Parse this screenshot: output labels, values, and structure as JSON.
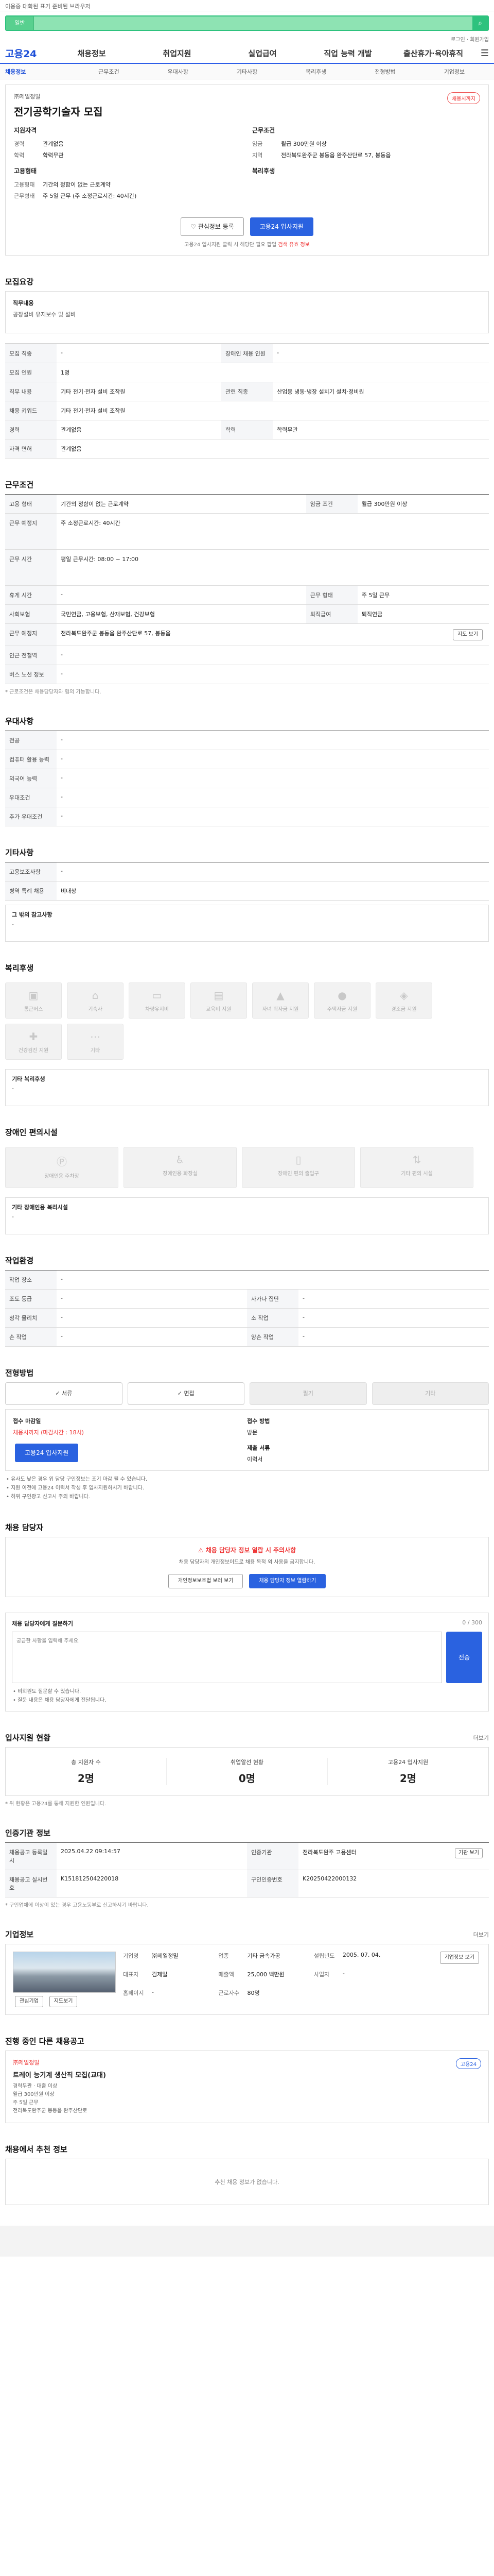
{
  "top": {
    "notice": "이용중 대화된 표기 준비된 브라우저"
  },
  "search": {
    "category": "일반",
    "placeholder": ""
  },
  "util": {
    "links": "로그인 · 회원가입"
  },
  "gnb": {
    "logo": "고용24",
    "items": [
      "채용정보",
      "취업지원",
      "실업급여",
      "직업 능력 개발",
      "출산휴가·육아휴직"
    ]
  },
  "subnav": [
    "채용정보",
    "근무조건",
    "우대사항",
    "기타사항",
    "복리후생",
    "전형방법",
    "기업정보"
  ],
  "hero": {
    "company": "㈜제일정밀",
    "title": "전기공학기술자 모집",
    "status": "채용시까지",
    "left_title": "지원자격",
    "left": [
      {
        "k": "경력",
        "v": "관계없음"
      },
      {
        "k": "학력",
        "v": "학력무관"
      }
    ],
    "left2_title": "고용형태",
    "left2": [
      {
        "k": "고용형태",
        "v": "기간의 정함이 없는 근로계약"
      },
      {
        "k": "근무형태",
        "v": "주 5일 근무 (주 소정근로시간: 40시간)"
      }
    ],
    "right_title": "근무조건",
    "right": [
      {
        "k": "임금",
        "v": "월급 300만원 이상"
      },
      {
        "k": "지역",
        "v": "전라북도완주군 봉동읍 완주산단로 57, 봉동읍"
      }
    ],
    "right2_title": "복리후생",
    "btn_like": "관심정보 등록",
    "btn_apply": "고용24 입사지원",
    "note": "고용24 입사지원 클릭 시 해당단 필요 팝업",
    "note_red": "검색 유효 정보"
  },
  "recruit": {
    "title": "모집요강",
    "desc_title": "직무내용",
    "desc": "공장설비 유지보수 및 설비",
    "rows": [
      [
        "모집 직종",
        "-",
        "장애인 채용 인원",
        "-"
      ],
      [
        "모집 인원",
        "1명",
        "",
        ""
      ],
      [
        "직무 내용",
        "기타 전기·전자 설비 조작원",
        "관련 직종",
        "산업용 냉동·냉장 설치기 설치·정비원"
      ],
      [
        "채용 키워드",
        "기타 전기·전자 설비 조작원",
        "",
        ""
      ],
      [
        "경력",
        "관계없음",
        "학력",
        "학력무관"
      ],
      [
        "자격 면허",
        "관계없음",
        "",
        ""
      ]
    ]
  },
  "work": {
    "title": "근무조건",
    "rows": [
      [
        "고용 형태",
        "기간의 정함이 없는 근로계약",
        "임금 조건",
        "월급 300만원 이상"
      ],
      [
        "근무 예정지",
        "주 소정근로시간: 40시간",
        "",
        ""
      ],
      [
        "근무 시간",
        "평일 근무시간: 08:00 ~ 17:00",
        "",
        ""
      ],
      [
        "휴게 시간",
        "-",
        "근무 형태",
        "주 5일 근무"
      ],
      [
        "사회보험",
        "국민연금, 고용보험, 산재보험, 건강보험",
        "퇴직급여",
        "퇴직연금"
      ],
      [
        "근무 예정지",
        "전라북도완주군 봉동읍 완주산단로 57, 봉동읍",
        "",
        ""
      ],
      [
        "인근 전철역",
        "-",
        "",
        ""
      ],
      [
        "버스 노선 정보",
        "-",
        "",
        ""
      ]
    ],
    "map_btn": "지도 보기",
    "note": "* 근로조건은 채용담당자와 협의 가능합니다."
  },
  "pref": {
    "title": "우대사항",
    "rows": [
      [
        "전공",
        "-"
      ],
      [
        "컴퓨터 활용 능력",
        "-"
      ],
      [
        "외국어 능력",
        "-"
      ],
      [
        "우대조건",
        "-"
      ],
      [
        "추가 우대조건",
        "-"
      ]
    ]
  },
  "etc": {
    "title": "기타사항",
    "rows": [
      [
        "고용보조사항",
        "-"
      ],
      [
        "병역 특례 채용",
        "비대상"
      ]
    ],
    "sub_title": "그 밖의 참고사항",
    "sub_text": "-"
  },
  "welfare": {
    "title": "복리후생",
    "tiles": [
      "통근버스",
      "기숙사",
      "차량유지비",
      "교육비 지원",
      "자녀 학자금 지원",
      "주택자금 지원",
      "경조금 지원",
      "건강검진 지원",
      "기타"
    ],
    "box_title": "기타 복리후생",
    "box_text": "-"
  },
  "disab": {
    "title": "장애인 편의시설",
    "tiles": [
      "장애인용 주차장",
      "장애인용 화장실",
      "장애인 편의 출입구",
      "기타 편의 시설"
    ],
    "box_title": "기타 장애인용 복리시설",
    "box_text": "-"
  },
  "env": {
    "title": "작업환경",
    "rows": [
      [
        "작업 장소",
        "-",
        "",
        ""
      ],
      [
        "조도 등급",
        "-",
        "사가나 집단",
        "-"
      ],
      [
        "청각 물리치",
        "-",
        "소 작업",
        "-"
      ],
      [
        "손 작업",
        "-",
        "양손 작업",
        "-"
      ]
    ]
  },
  "method": {
    "title": "전형방법",
    "chips": [
      "서류",
      "면접",
      "필기",
      "기타"
    ],
    "chip_off": [
      false,
      false,
      true,
      true
    ],
    "deadline_label": "접수 마감일",
    "deadline": "채용시까지 (마감시간 : 18시)",
    "apply_label": "접수 방법",
    "apply_value": "방문",
    "doc_label": "제출 서류",
    "doc_value": "이력서",
    "btn": "고용24 입사지원",
    "bullets": [
      "• 유사도 낮은 경우 위 담당 구인정보는 조기 마감 될 수 있습니다.",
      "• 지원 이전에 고용24 이력서 작성 후 입사지원하시기 바랍니다.",
      "• 허위 구인광고 신고시 주의 바랍니다."
    ]
  },
  "manager": {
    "title": "채용 담당자",
    "warn": "채용 담당자 정보 열람 시 주의사항",
    "text": "채용 담당자의 개인정보이므로 채용 목적 외 사용을 금지합니다.",
    "btn1": "개인정보보호법 보러 보기",
    "btn2": "채용 담당자 정보 열람하기"
  },
  "qa": {
    "title": "채용 담당자에게 질문하기",
    "counter": "0 / 300",
    "placeholder": "궁금한 사항을 입력해 주세요.",
    "send": "전송",
    "notes": [
      "• 비회원도 질문할 수 있습니다.",
      "• 질문 내용은 채용 담당자에게 전달됩니다."
    ]
  },
  "stats": {
    "title": "입사지원 현황",
    "more": "더보기",
    "items": [
      {
        "l": "총 지원자 수",
        "n": "2명"
      },
      {
        "l": "취업알선 현황 ",
        "n": "0명"
      },
      {
        "l": "고용24 입사지원",
        "n": "2명"
      }
    ],
    "note": "* 위 현황은 고용24를 통해 지원한 인원입니다."
  },
  "reginfo": {
    "title": "인증기관 정보",
    "rows": [
      [
        "채용공고 등록일시",
        "2025.04.22 09:14:57",
        "인증기관",
        "전라북도완주 고용센터"
      ],
      [
        "채용공고 실시번호",
        "K151812504220018",
        "구인인증번호",
        "K20250422000132"
      ]
    ],
    "btn": "기관 보기",
    "note": "* 구인업체에 이상이 있는 경우 고용노동부로 신고하시기 바랍니다."
  },
  "corp": {
    "title": "기업정보",
    "more": "더보기",
    "rows": [
      {
        "k": "기업명",
        "v": "㈜제일정밀"
      },
      {
        "k": "업종",
        "v": "기타 금속가공"
      },
      {
        "k": "설립년도",
        "v": "2005. 07. 04."
      },
      {
        "k": "대표자",
        "v": "김제일"
      },
      {
        "k": "매출액",
        "v": "25,000 백만원"
      },
      {
        "k": "사업자",
        "v": "-"
      },
      {
        "k": "홈페이지",
        "v": "-"
      },
      {
        "k": "근로자수",
        "v": "80명"
      }
    ],
    "btn_like": "관심기업",
    "btn_info": "기업정보 보기",
    "btn_map": "지도보기"
  },
  "other": {
    "title": "진행 중인 다른 채용공고",
    "item_company": "㈜제일정밀",
    "item_title": "트레이 능기계 생산직 모집(교대)",
    "item_meta": [
      "경력무관 · 대졸 이상",
      "월급 300만원 이상",
      "주 5일 근무",
      "전라북도완주군 봉동읍 완주산단로"
    ],
    "badge": "고용24"
  },
  "bottom": {
    "title": "채용에서 추천 정보",
    "empty": "추천 채용 정보가 없습니다."
  }
}
